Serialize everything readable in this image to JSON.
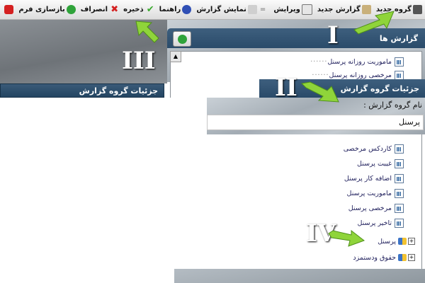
{
  "toolbar": {
    "buttons": [
      {
        "label": "گروه جدید",
        "icon": "printer-group-icon",
        "color": "#555555"
      },
      {
        "label": "گزارش جدید",
        "icon": "new-report-icon",
        "color": "#8a6f3f"
      },
      {
        "label": "ویرایش",
        "icon": "edit-icon",
        "color": "#6b6b6b"
      },
      {
        "label": "=",
        "icon": "",
        "color": "#666666"
      },
      {
        "label": "نمایش گزارش",
        "icon": "view-report-icon",
        "color": "#9a9a9a"
      },
      {
        "label": "راهنما",
        "icon": "help-icon",
        "color": "#2f4fb5"
      },
      {
        "label": "ذخیره",
        "icon": "save-check-icon",
        "color": "#3cab2f"
      },
      {
        "label": "انصراف",
        "icon": "cancel-x-icon",
        "color": "#d42020"
      },
      {
        "label": "بازسازی فرم",
        "icon": "refresh-form-icon",
        "color": "#2fa33a"
      }
    ],
    "close_icon_color": "#d42020"
  },
  "left_panel": {
    "header": "جزئیات گروه گزارش"
  },
  "reports_panel": {
    "header": "گزارش ها",
    "tree_top": [
      "ماموریت روزانه پرسنل",
      "مرخصی روزانه پرسنل"
    ],
    "tree_items": [
      "کاردکس مرخصی",
      "غیبت پرسنل",
      "اضافه کار پرسنل",
      "ماموریت پرسنل",
      "مرخصی پرسنل",
      "تاخیر پرسنل"
    ],
    "groups": [
      "پرسنل",
      "حقوق ودستمزد"
    ]
  },
  "details_panel": {
    "header": "جزئیات گروه گزارش",
    "group_name_label": "نام گروه گزارش :",
    "group_name_value": "پرسنل"
  },
  "annotations": {
    "i": "I",
    "ii": "II",
    "iii": "III",
    "iv": "IV"
  },
  "colors": {
    "header_blue": "#2a4b6a",
    "arrow_green": "#8fd43a"
  }
}
